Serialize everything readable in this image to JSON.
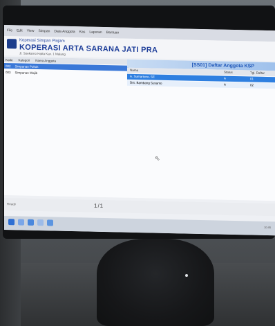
{
  "menu": {
    "items": [
      "File",
      "Edit",
      "View",
      "Simpan",
      "Data Anggota",
      "Kas",
      "Laporan",
      "Bantuan"
    ]
  },
  "header": {
    "org_line": "Koperasi Simpan Pinjam",
    "org_name": "KOPERASI ARTA SARANA JATI PRA",
    "org_sub": "Jl. Soekarno Hatta Kav. 1 Malang"
  },
  "tree": {
    "columns": [
      "Kode",
      "Kategori",
      "Nama Anggota"
    ],
    "rows": [
      {
        "code": "002",
        "cat": "Simpanan Pokok",
        "name": ""
      },
      {
        "code": "003",
        "cat": "Simpanan Wajib",
        "name": ""
      }
    ]
  },
  "list": {
    "title": "[SS01] Daftar Anggota KSP",
    "columns": {
      "name": "Nama",
      "status": "Status",
      "date": "Tgl. Daftar"
    },
    "rows": [
      {
        "name": "A. Sumartono, SE",
        "status": "A",
        "date": "01"
      },
      {
        "name": "Drs. Bambang Susanto",
        "status": "A",
        "date": "02"
      }
    ]
  },
  "footer": {
    "left": "Ready",
    "page": "1/1"
  },
  "tray": {
    "clock": "10:45"
  }
}
